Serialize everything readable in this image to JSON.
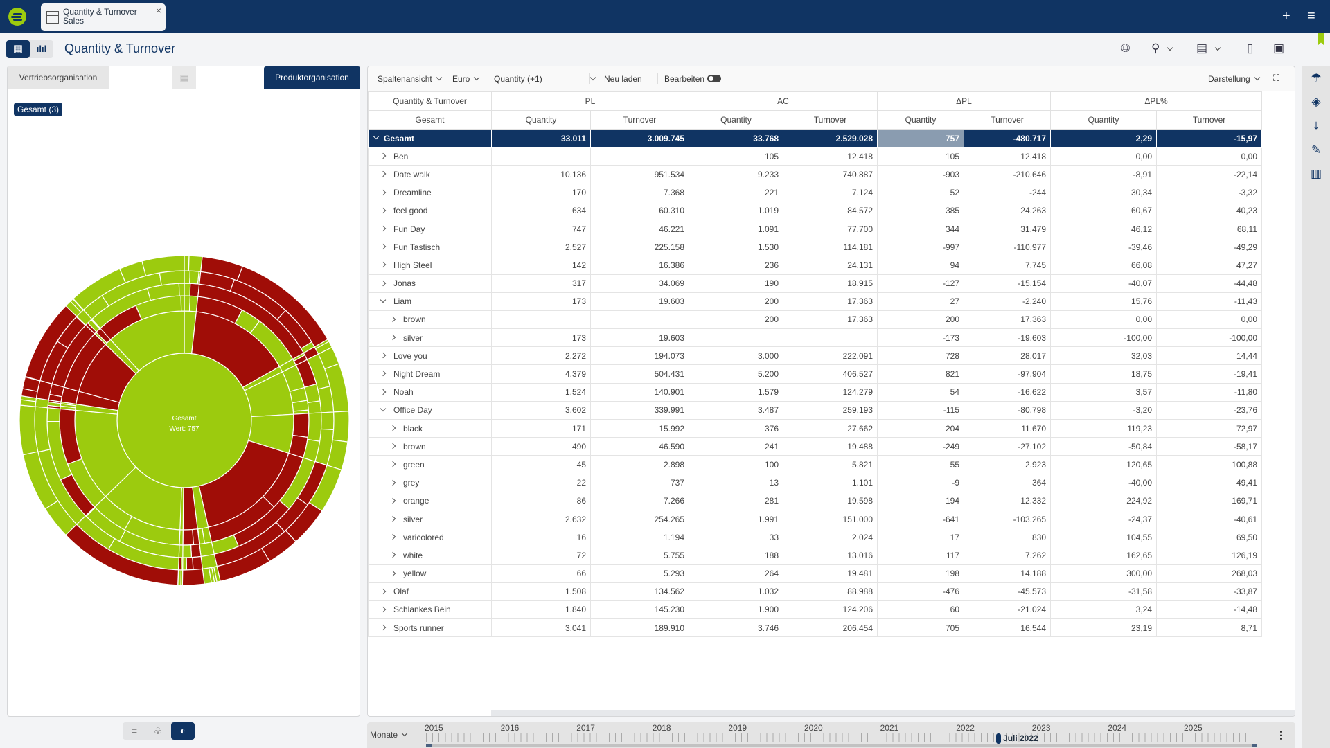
{
  "app": {
    "tab": {
      "line1": "Quantity & Turnover",
      "line2": "Sales",
      "close": "×"
    },
    "add_icon": "+",
    "menu_icon": "≡"
  },
  "header": {
    "title": "Quantity & Turnover",
    "view_table_icon": "▦",
    "view_chart_icon": "ılıl"
  },
  "left_panel": {
    "tab_sales": "Vertriebsorganisation",
    "tab_product": "Produktorganisation",
    "filter_chip": "Gesamt (3)",
    "bottom_toggle": [
      "≡",
      "♧",
      "◐"
    ]
  },
  "toolbar": {
    "column_view": "Spaltenansicht",
    "currency": "Euro",
    "measure": "Quantity (+1)",
    "reload": "Neu laden",
    "edit": "Bearbeiten",
    "display": "Darstellung",
    "edit_enabled": false
  },
  "table": {
    "group_headers": [
      "Quantity & Turnover",
      "PL",
      "AC",
      "ΔPL",
      "ΔPL%"
    ],
    "sub_headers": [
      "Gesamt",
      "Quantity",
      "Turnover",
      "Quantity",
      "Turnover",
      "Quantity",
      "Turnover",
      "Quantity",
      "Turnover"
    ],
    "rows": [
      {
        "name": "Gesamt",
        "level": 0,
        "expanded": true,
        "total": true,
        "values": [
          "33.011",
          "3.009.745",
          "33.768",
          "2.529.028",
          "757",
          "-480.717",
          "2,29",
          "-15,97"
        ]
      },
      {
        "name": "Ben",
        "level": 1,
        "expanded": false,
        "values": [
          "",
          "",
          "105",
          "12.418",
          "105",
          "12.418",
          "0,00",
          "0,00"
        ]
      },
      {
        "name": "Date walk",
        "level": 1,
        "expanded": false,
        "values": [
          "10.136",
          "951.534",
          "9.233",
          "740.887",
          "-903",
          "-210.646",
          "-8,91",
          "-22,14"
        ]
      },
      {
        "name": "Dreamline",
        "level": 1,
        "expanded": false,
        "values": [
          "170",
          "7.368",
          "221",
          "7.124",
          "52",
          "-244",
          "30,34",
          "-3,32"
        ]
      },
      {
        "name": "feel good",
        "level": 1,
        "expanded": false,
        "values": [
          "634",
          "60.310",
          "1.019",
          "84.572",
          "385",
          "24.263",
          "60,67",
          "40,23"
        ]
      },
      {
        "name": "Fun Day",
        "level": 1,
        "expanded": false,
        "values": [
          "747",
          "46.221",
          "1.091",
          "77.700",
          "344",
          "31.479",
          "46,12",
          "68,11"
        ]
      },
      {
        "name": "Fun Tastisch",
        "level": 1,
        "expanded": false,
        "values": [
          "2.527",
          "225.158",
          "1.530",
          "114.181",
          "-997",
          "-110.977",
          "-39,46",
          "-49,29"
        ]
      },
      {
        "name": "High Steel",
        "level": 1,
        "expanded": false,
        "values": [
          "142",
          "16.386",
          "236",
          "24.131",
          "94",
          "7.745",
          "66,08",
          "47,27"
        ]
      },
      {
        "name": "Jonas",
        "level": 1,
        "expanded": false,
        "values": [
          "317",
          "34.069",
          "190",
          "18.915",
          "-127",
          "-15.154",
          "-40,07",
          "-44,48"
        ]
      },
      {
        "name": "Liam",
        "level": 1,
        "expanded": true,
        "values": [
          "173",
          "19.603",
          "200",
          "17.363",
          "27",
          "-2.240",
          "15,76",
          "-11,43"
        ]
      },
      {
        "name": "brown",
        "level": 2,
        "expanded": false,
        "values": [
          "",
          "",
          "200",
          "17.363",
          "200",
          "17.363",
          "0,00",
          "0,00"
        ]
      },
      {
        "name": "silver",
        "level": 2,
        "expanded": false,
        "values": [
          "173",
          "19.603",
          "",
          "",
          "-173",
          "-19.603",
          "-100,00",
          "-100,00"
        ]
      },
      {
        "name": "Love you",
        "level": 1,
        "expanded": false,
        "values": [
          "2.272",
          "194.073",
          "3.000",
          "222.091",
          "728",
          "28.017",
          "32,03",
          "14,44"
        ]
      },
      {
        "name": "Night Dream",
        "level": 1,
        "expanded": false,
        "values": [
          "4.379",
          "504.431",
          "5.200",
          "406.527",
          "821",
          "-97.904",
          "18,75",
          "-19,41"
        ]
      },
      {
        "name": "Noah",
        "level": 1,
        "expanded": false,
        "values": [
          "1.524",
          "140.901",
          "1.579",
          "124.279",
          "54",
          "-16.622",
          "3,57",
          "-11,80"
        ]
      },
      {
        "name": "Office Day",
        "level": 1,
        "expanded": true,
        "values": [
          "3.602",
          "339.991",
          "3.487",
          "259.193",
          "-115",
          "-80.798",
          "-3,20",
          "-23,76"
        ]
      },
      {
        "name": "black",
        "level": 2,
        "expanded": false,
        "values": [
          "171",
          "15.992",
          "376",
          "27.662",
          "204",
          "11.670",
          "119,23",
          "72,97"
        ]
      },
      {
        "name": "brown",
        "level": 2,
        "expanded": false,
        "values": [
          "490",
          "46.590",
          "241",
          "19.488",
          "-249",
          "-27.102",
          "-50,84",
          "-58,17"
        ]
      },
      {
        "name": "green",
        "level": 2,
        "expanded": false,
        "values": [
          "45",
          "2.898",
          "100",
          "5.821",
          "55",
          "2.923",
          "120,65",
          "100,88"
        ]
      },
      {
        "name": "grey",
        "level": 2,
        "expanded": false,
        "values": [
          "22",
          "737",
          "13",
          "1.101",
          "-9",
          "364",
          "-40,00",
          "49,41"
        ]
      },
      {
        "name": "orange",
        "level": 2,
        "expanded": false,
        "values": [
          "86",
          "7.266",
          "281",
          "19.598",
          "194",
          "12.332",
          "224,92",
          "169,71"
        ]
      },
      {
        "name": "silver",
        "level": 2,
        "expanded": false,
        "values": [
          "2.632",
          "254.265",
          "1.991",
          "151.000",
          "-641",
          "-103.265",
          "-24,37",
          "-40,61"
        ]
      },
      {
        "name": "varicolored",
        "level": 2,
        "expanded": false,
        "values": [
          "16",
          "1.194",
          "33",
          "2.024",
          "17",
          "830",
          "104,55",
          "69,50"
        ]
      },
      {
        "name": "white",
        "level": 2,
        "expanded": false,
        "values": [
          "72",
          "5.755",
          "188",
          "13.016",
          "117",
          "7.262",
          "162,65",
          "126,19"
        ]
      },
      {
        "name": "yellow",
        "level": 2,
        "expanded": false,
        "values": [
          "66",
          "5.293",
          "264",
          "19.481",
          "198",
          "14.188",
          "300,00",
          "268,03"
        ]
      },
      {
        "name": "Olaf",
        "level": 1,
        "expanded": false,
        "values": [
          "1.508",
          "134.562",
          "1.032",
          "88.988",
          "-476",
          "-45.573",
          "-31,58",
          "-33,87"
        ]
      },
      {
        "name": "Schlankes Bein",
        "level": 1,
        "expanded": false,
        "values": [
          "1.840",
          "145.230",
          "1.900",
          "124.206",
          "60",
          "-21.024",
          "3,24",
          "-14,48"
        ]
      },
      {
        "name": "Sports runner",
        "level": 1,
        "expanded": false,
        "values": [
          "3.041",
          "189.910",
          "3.746",
          "206.454",
          "705",
          "16.544",
          "23,19",
          "8,71"
        ]
      }
    ]
  },
  "timeline": {
    "granularity": "Monate",
    "years": [
      "2015",
      "2016",
      "2017",
      "2018",
      "2019",
      "2020",
      "2021",
      "2022",
      "2023",
      "2024",
      "2025"
    ],
    "selected": "Juli 2022",
    "more": "⋮"
  },
  "chart_data": {
    "type": "sunburst",
    "title": "",
    "center_label": "Gesamt",
    "center_value_label": "Wert: 757",
    "center_value": 757,
    "positive_color": "#9ccb0e",
    "negative_color": "#a00d07",
    "rings": [
      {
        "level": "Produkt",
        "segments": [
          {
            "name": "Ben",
            "value": 105
          },
          {
            "name": "Date walk",
            "value": -903
          },
          {
            "name": "Dreamline",
            "value": 52
          },
          {
            "name": "feel good",
            "value": 385
          },
          {
            "name": "Fun Day",
            "value": 344
          },
          {
            "name": "Fun Tastisch",
            "value": -997
          },
          {
            "name": "High Steel",
            "value": 94
          },
          {
            "name": "Jonas",
            "value": -127
          },
          {
            "name": "Liam",
            "value": 27
          },
          {
            "name": "Love you",
            "value": 728
          },
          {
            "name": "Night Dream",
            "value": 821
          },
          {
            "name": "Noah",
            "value": 54
          },
          {
            "name": "Office Day",
            "value": -115
          },
          {
            "name": "Olaf",
            "value": -476
          },
          {
            "name": "Schlankes Bein",
            "value": 60
          },
          {
            "name": "Sports runner",
            "value": 705
          }
        ]
      }
    ]
  }
}
